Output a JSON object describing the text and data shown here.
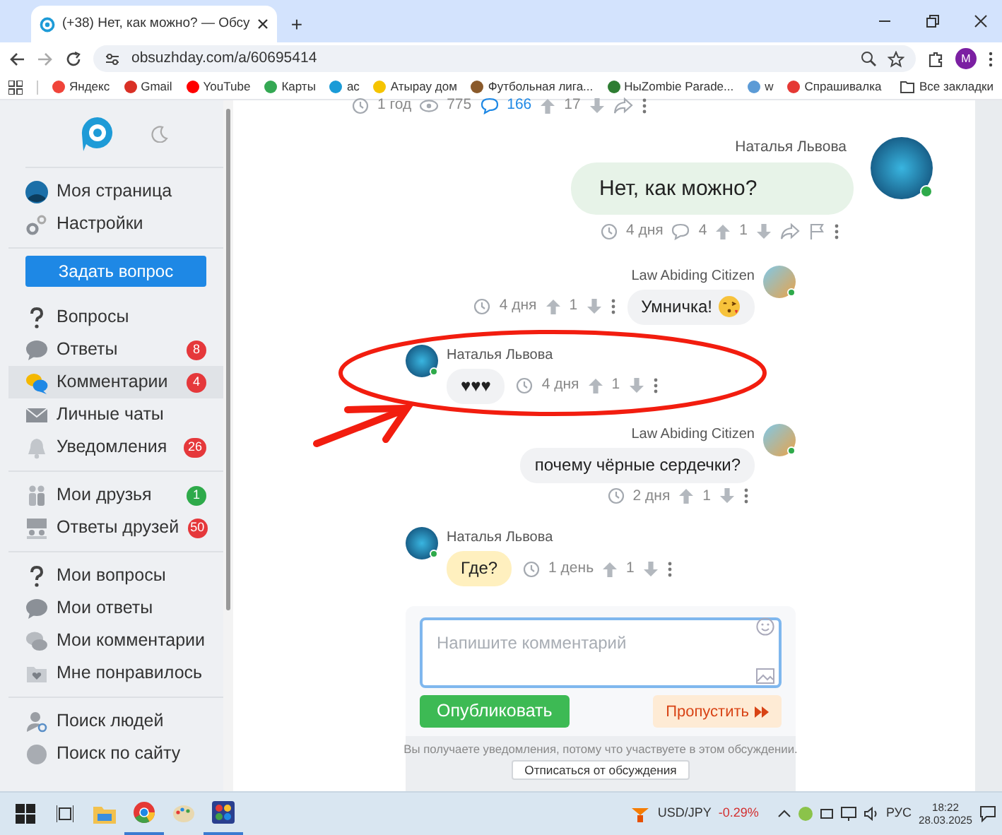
{
  "browser": {
    "tab_title": "(+38) Нет, как можно? — Обсу",
    "new_tab": "+",
    "url": "obsuzhday.com/a/60695414",
    "profile_initial": "M",
    "bookmarks": [
      {
        "label": "Яндекс",
        "color": "#f0443a"
      },
      {
        "label": "Gmail",
        "color": "#d93025"
      },
      {
        "label": "YouTube",
        "color": "#ff0000"
      },
      {
        "label": "Карты",
        "color": "#34a853"
      },
      {
        "label": "ас",
        "color": "#1a9bd7"
      },
      {
        "label": "Атырау дом",
        "color": "#f5c400"
      },
      {
        "label": "Футбольная лига...",
        "color": "#8a5a2b"
      },
      {
        "label": "HыZombie Parade...",
        "color": "#2e7d32"
      },
      {
        "label": "w",
        "color": "#5c9bd6"
      },
      {
        "label": "Спрашивалка",
        "color": "#e53935"
      }
    ],
    "all_bookmarks": "Все закладки"
  },
  "sidebar": {
    "ask_button": "Задать вопрос",
    "groups": [
      [
        {
          "label": "Моя страница",
          "selected": false
        },
        {
          "label": "Настройки",
          "selected": false
        }
      ],
      [
        {
          "label": "Вопросы",
          "selected": false
        },
        {
          "label": "Ответы",
          "badge": "8",
          "color": "#e5383b",
          "selected": false
        },
        {
          "label": "Комментарии",
          "badge": "4",
          "color": "#e5383b",
          "selected": true
        },
        {
          "label": "Личные чаты",
          "selected": false
        },
        {
          "label": "Уведомления",
          "badge": "26",
          "color": "#e5383b",
          "selected": false
        }
      ],
      [
        {
          "label": "Мои друзья",
          "badge": "1",
          "color": "#2eaa4a",
          "selected": false
        },
        {
          "label": "Ответы друзей",
          "badge": "50",
          "color": "#e5383b",
          "selected": false
        }
      ],
      [
        {
          "label": "Мои вопросы",
          "selected": false
        },
        {
          "label": "Мои ответы",
          "selected": false
        },
        {
          "label": "Мои комментарии",
          "selected": false
        },
        {
          "label": "Мне понравилось",
          "selected": false
        }
      ],
      [
        {
          "label": "Поиск людей",
          "selected": false
        },
        {
          "label": "Поиск по сайту",
          "selected": false
        }
      ]
    ]
  },
  "question_meta": {
    "time": "1 год",
    "views": "775",
    "comments": "166",
    "votes": "17"
  },
  "comments": [
    {
      "kind": "main",
      "author": "Наталья Львова",
      "text": "Нет, как можно?",
      "color": "#e7f3e8",
      "online": true,
      "time": "4 дня",
      "replies": "4",
      "votes": "1"
    },
    {
      "kind": "rightinline",
      "author": "Law Abiding Citizen",
      "text": "Умничка!",
      "color": "#f1f2f4",
      "online": true,
      "time": "4 дня",
      "votes": "1"
    },
    {
      "kind": "left",
      "author": "Наталья Львова",
      "text": "♥♥♥",
      "color": "#f1f2f4",
      "online": true,
      "time": "4 дня",
      "votes": "1"
    },
    {
      "kind": "right",
      "author": "Law Abiding Citizen",
      "text": "почему чёрные сердечки?",
      "color": "#f1f2f4",
      "online": true,
      "time": "2 дня",
      "votes": "1"
    },
    {
      "kind": "left",
      "author": "Наталья Львова",
      "text": "Где?",
      "color": "#fff0bf",
      "online": true,
      "time": "1 день",
      "votes": "1"
    }
  ],
  "composer": {
    "placeholder": "Напишите комментарий",
    "publish": "Опубликовать",
    "skip": "Пропустить",
    "notice": "Вы получаете уведомления, потому что участвуете в этом обсуждении.",
    "unsubscribe": "Отписаться от обсуждения"
  },
  "taskbar": {
    "ticker": "USD/JPY",
    "change": "-0.29%",
    "language": "РУС",
    "time": "18:22",
    "date": "28.03.2025"
  }
}
